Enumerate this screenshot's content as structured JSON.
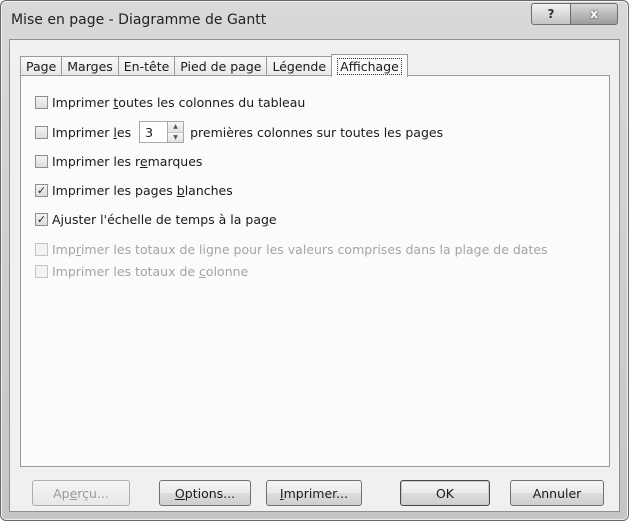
{
  "window": {
    "title": "Mise en page - Diagramme de Gantt"
  },
  "titlebar_buttons": {
    "help": "?",
    "close": "x"
  },
  "tabs": [
    {
      "label": "Page"
    },
    {
      "label": "Marges"
    },
    {
      "label": "En-tête"
    },
    {
      "label": "Pied de page"
    },
    {
      "label": "Légende"
    },
    {
      "label": "Affichage",
      "active": true
    }
  ],
  "options": {
    "print_all_columns": {
      "pre": "Imprimer ",
      "u": "t",
      "post": "outes les colonnes du tableau",
      "checked": false
    },
    "print_first_cols": {
      "pre": "Imprimer ",
      "u": "l",
      "post": "es",
      "value": "3",
      "suffix": "premières colonnes sur toutes les pages",
      "checked": false
    },
    "print_notes": {
      "pre": "Imprimer les r",
      "u": "e",
      "post": "marques",
      "checked": false
    },
    "print_blank": {
      "pre": "Imprimer les pages ",
      "u": "b",
      "post": "lanches",
      "checked": true
    },
    "fit_timescale": {
      "pre": "Ajuster l'échelle de temps à la pa",
      "u": "g",
      "post": "e",
      "checked": true
    },
    "row_totals": {
      "pre": "Imp",
      "u": "r",
      "post": "imer les totaux de ligne pour les valeurs comprises dans la plage de dates",
      "checked": false,
      "disabled": true
    },
    "col_totals": {
      "pre": "Imprimer les totaux de ",
      "u": "c",
      "post": "olonne",
      "checked": false,
      "disabled": true
    }
  },
  "buttons": {
    "preview": {
      "pre": "Ap",
      "u": "e",
      "post": "rçu...",
      "disabled": true
    },
    "options": {
      "pre": "",
      "u": "O",
      "post": "ptions..."
    },
    "print": {
      "pre": "",
      "u": "I",
      "post": "mprimer..."
    },
    "ok": {
      "label": "OK"
    },
    "cancel": {
      "label": "Annuler"
    }
  },
  "check_glyph": "✓"
}
